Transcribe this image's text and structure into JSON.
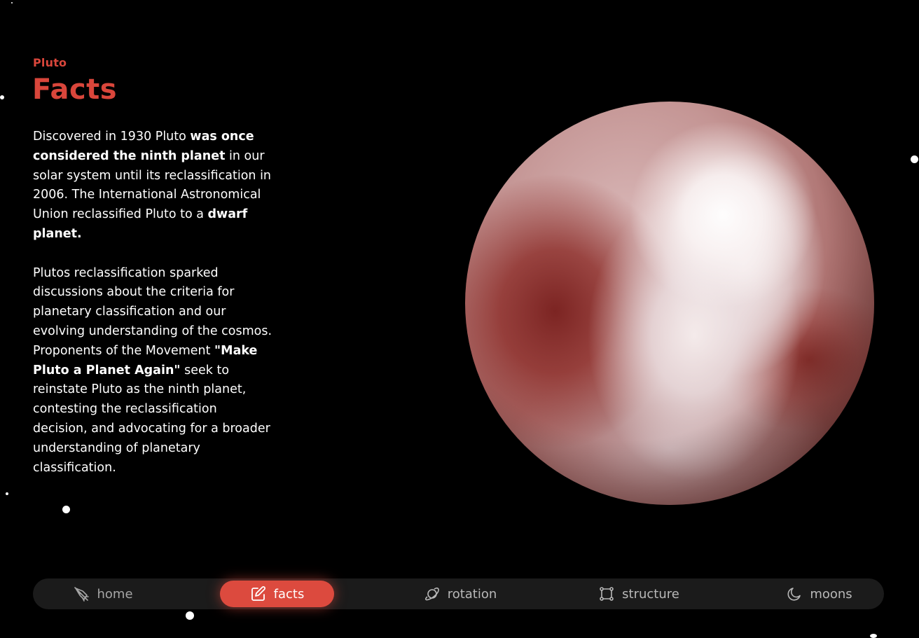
{
  "header": {
    "kicker": "Pluto",
    "title": "Facts"
  },
  "content": {
    "p1": {
      "t1": "Discovered in 1930 Pluto ",
      "b1": "was once considered the ninth planet",
      "t2": " in our solar system until its reclassification in 2006. The International Astronomical Union reclassified Pluto to a ",
      "b2": "dwarf planet."
    },
    "p2": {
      "t1": "Plutos reclassification sparked discussions about the criteria for planetary classification and our evolving understanding of the cosmos. Proponents of the Movement ",
      "b1": "\"Make Pluto a Planet Again\"",
      "t2": " seek to reinstate Pluto as the ninth planet, contesting the reclassification decision, and advocating for a broader understanding of planetary classification."
    }
  },
  "nav": {
    "items": [
      {
        "label": "home",
        "icon": "rocket-icon"
      },
      {
        "label": "facts",
        "icon": "edit-icon"
      },
      {
        "label": "rotation",
        "icon": "planet-icon"
      },
      {
        "label": "structure",
        "icon": "nodes-icon"
      },
      {
        "label": "moons",
        "icon": "moon-icon"
      }
    ],
    "active_index": 1,
    "accent_color": "#dc4a3e"
  }
}
